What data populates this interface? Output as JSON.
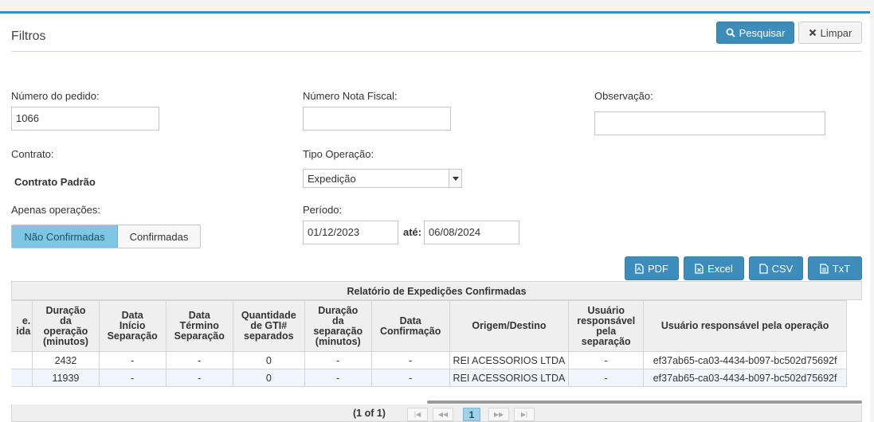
{
  "filters": {
    "title": "Filtros",
    "search_button": "Pesquisar",
    "clear_button": "Limpar",
    "order_number": {
      "label": "Número do pedido:",
      "value": "1066"
    },
    "invoice_number": {
      "label": "Número Nota Fiscal:",
      "value": ""
    },
    "observation": {
      "label": "Observação:",
      "value": ""
    },
    "contract": {
      "label": "Contrato:",
      "value": "Contrato Padrão"
    },
    "operation_type": {
      "label": "Tipo Operação:",
      "value": "Expedição"
    },
    "only_operations": {
      "label": "Apenas operações:",
      "options": [
        "Não Confirmadas",
        "Confirmadas"
      ],
      "selected": "Não Confirmadas"
    },
    "period": {
      "label": "Período:",
      "from": "01/12/2023",
      "separator": "até:",
      "to": "06/08/2024"
    }
  },
  "export": {
    "pdf": "PDF",
    "excel": "Excel",
    "csv": "CSV",
    "txt": "TxT"
  },
  "report": {
    "caption": "Relatório de Expedições Confirmadas",
    "columns": [
      "e.\nida",
      "Duração\nda\noperação\n(minutos)",
      "Data\nInício\nSeparação",
      "Data\nTérmino\nSeparação",
      "Quantidade\nde GTI#\nseparados",
      "Duração\nda\nseparação\n(minutos)",
      "Data\nConfirmação",
      "Origem/Destino",
      "Usuário\nresponsável\npela\nseparação",
      "Usuário responsável pela operação"
    ],
    "rows": [
      [
        "",
        "2432",
        "-",
        "-",
        "0",
        "-",
        "-",
        "REI ACESSORIOS LTDA",
        "-",
        "ef37ab65-ca03-4434-b097-bc502d75692f"
      ],
      [
        "",
        "11939",
        "-",
        "-",
        "0",
        "-",
        "-",
        "REI ACESSORIOS LTDA",
        "-",
        "ef37ab65-ca03-4434-b097-bc502d75692f"
      ]
    ]
  },
  "pager": {
    "info": "(1 of 1)",
    "current_page": "1"
  }
}
